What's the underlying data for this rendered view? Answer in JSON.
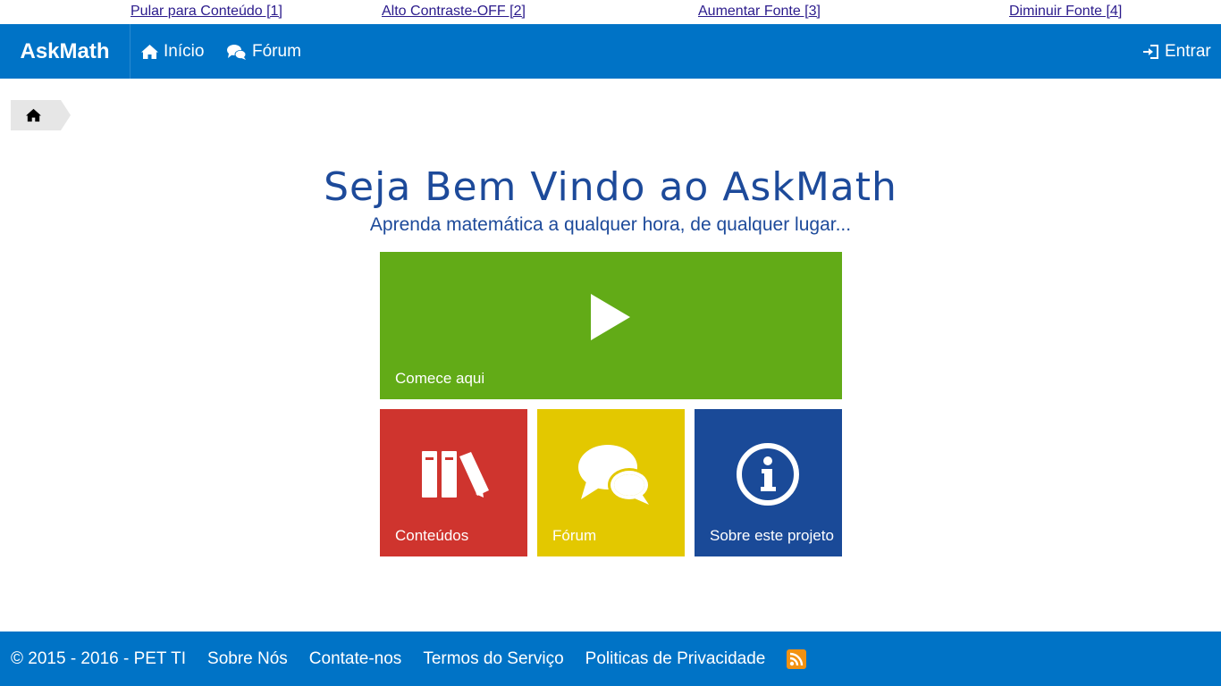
{
  "accessibility": {
    "skip_content": "Pular para Conteúdo [1]",
    "high_contrast": "Alto Contraste-OFF [2]",
    "increase_font": "Aumentar Fonte [3]",
    "decrease_font": "Diminuir Fonte [4]"
  },
  "navbar": {
    "brand": "AskMath",
    "home_label": "Início",
    "forum_label": "Fórum",
    "login_label": "Entrar"
  },
  "hero": {
    "title": "Seja Bem Vindo ao AskMath",
    "subtitle": "Aprenda matemática a qualquer hora, de qualquer lugar..."
  },
  "tiles": {
    "start": "Comece aqui",
    "contents": "Conteúdos",
    "forum": "Fórum",
    "about": "Sobre este projeto"
  },
  "footer": {
    "copyright": "© 2015 - 2016 - PET TI",
    "about_us": "Sobre Nós",
    "contact": "Contate-nos",
    "terms": "Termos do Serviço",
    "privacy": "Politicas de Privacidade"
  },
  "colors": {
    "primary": "#0073c6",
    "green": "#62ab17",
    "red": "#cf342e",
    "yellow": "#e3c800",
    "blue": "#1a4a98"
  },
  "icons": {
    "home": "home-icon",
    "forum": "chat-bubbles-icon",
    "login": "sign-in-icon",
    "play": "play-icon",
    "books": "books-icon",
    "info": "info-icon",
    "rss": "rss-icon"
  }
}
